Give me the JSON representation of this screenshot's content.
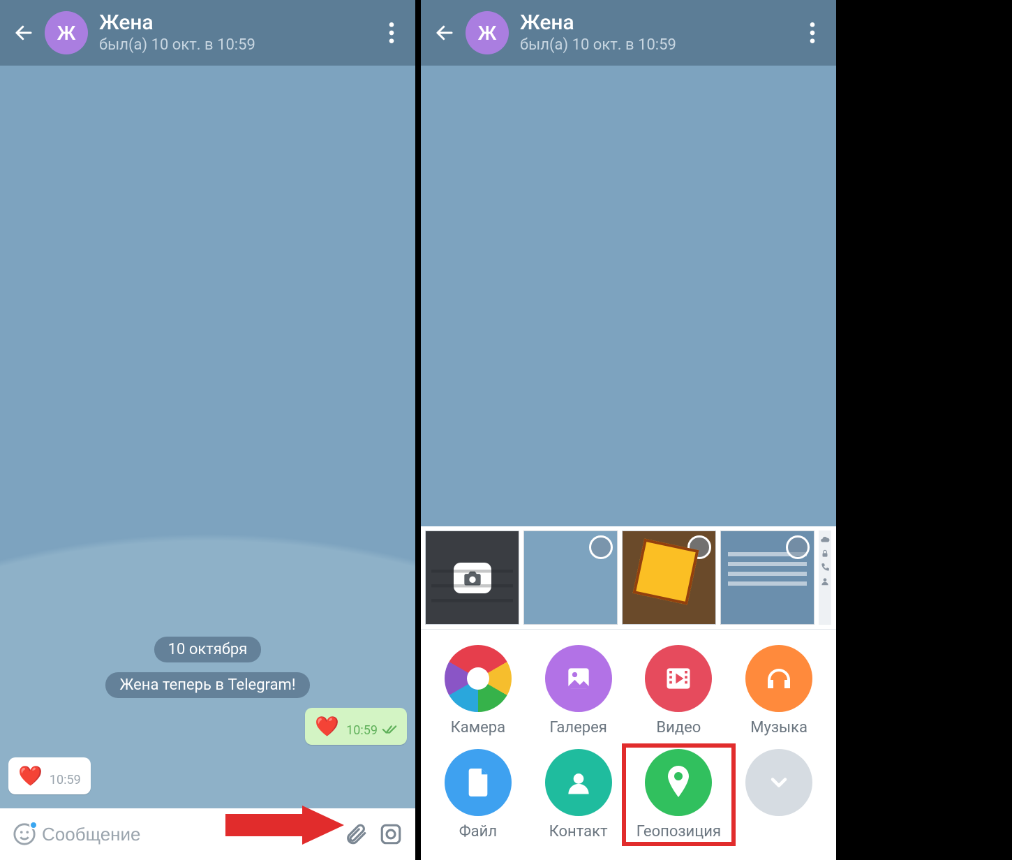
{
  "header": {
    "avatar_letter": "Ж",
    "title": "Жена",
    "status": "был(а) 10 окт. в 10:59"
  },
  "chat": {
    "date_label": "10 октября",
    "joined_label": "Жена теперь в Telegram!",
    "out": {
      "emoji": "❤️",
      "time": "10:59"
    },
    "in": {
      "emoji": "❤️",
      "time": "10:59"
    }
  },
  "input": {
    "placeholder": "Сообщение"
  },
  "attach": {
    "camera": "Камера",
    "gallery": "Галерея",
    "video": "Видео",
    "music": "Музыка",
    "file": "Файл",
    "contact": "Контакт",
    "location": "Геопозиция"
  }
}
